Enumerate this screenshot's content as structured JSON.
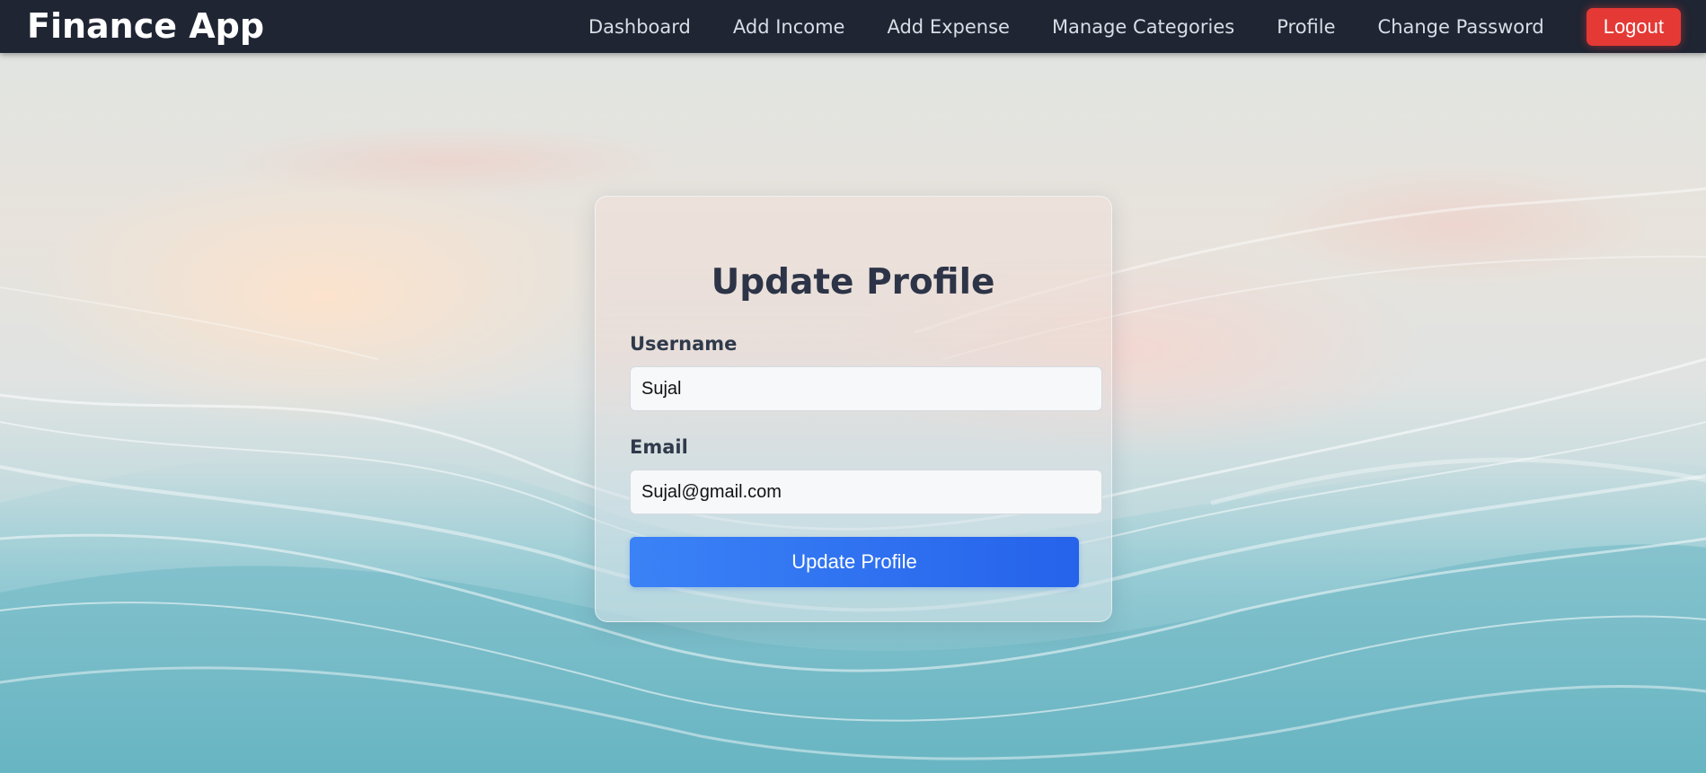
{
  "app": {
    "brand": "Finance App"
  },
  "nav": {
    "items": [
      {
        "label": "Dashboard"
      },
      {
        "label": "Add Income"
      },
      {
        "label": "Add Expense"
      },
      {
        "label": "Manage Categories"
      },
      {
        "label": "Profile"
      },
      {
        "label": "Change Password"
      }
    ],
    "logout_label": "Logout"
  },
  "form": {
    "title": "Update Profile",
    "username_label": "Username",
    "username_value": "Sujal",
    "email_label": "Email",
    "email_value": "Sujal@gmail.com",
    "submit_label": "Update Profile"
  },
  "colors": {
    "navbar": "#1f2533",
    "logout": "#e53935",
    "primary": "#3b82f6",
    "title_text": "#2d3447"
  }
}
